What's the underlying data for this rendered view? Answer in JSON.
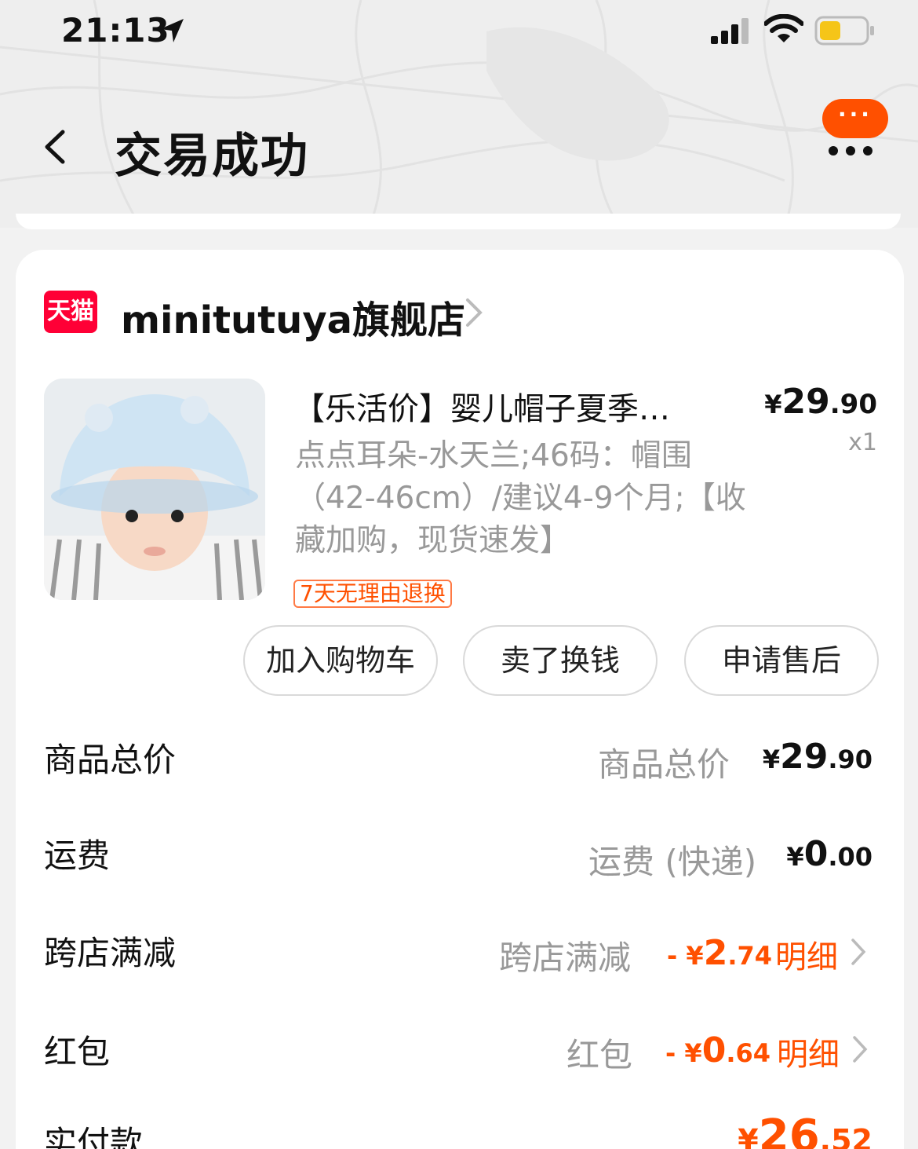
{
  "status_bar": {
    "time": "21:13"
  },
  "header": {
    "title": "交易成功",
    "more_label": "···"
  },
  "shop": {
    "logo_text": "天猫",
    "name": "minitutuya旗舰店"
  },
  "product": {
    "title": "【乐活价】婴儿帽子夏季…",
    "price_currency": "¥",
    "price_int": "29",
    "price_dec": ".90",
    "qty": "x1",
    "sku": "点点耳朵-水天兰;46码：帽围（42-46cm）/建议4-9个月;【收藏加购，现货速发】",
    "return_badge": "7天无理由退换",
    "buttons": [
      "加入购物车",
      "卖了换钱",
      "申请售后"
    ]
  },
  "summary": {
    "goods_total": {
      "label": "商品总价",
      "sub": "商品总价",
      "cur": "¥",
      "int": "29",
      "dec": ".90"
    },
    "shipping": {
      "label": "运费",
      "sub": "运费 (快递)",
      "cur": "¥",
      "int": "0",
      "dec": ".00"
    },
    "cross_store_discount": {
      "label": "跨店满减",
      "sub": "跨店满减",
      "cur": "- ¥",
      "int": "2",
      "dec": ".74",
      "link": "明细"
    },
    "red_packet": {
      "label": "红包",
      "sub": "红包",
      "cur": "- ¥",
      "int": "0",
      "dec": ".64",
      "link": "明细"
    },
    "paid": {
      "label": "实付款",
      "cur": "¥",
      "int": "26",
      "dec": ".52"
    }
  },
  "colors": {
    "accent": "#ff5000",
    "tmall": "#ff0036",
    "muted": "#999999"
  }
}
